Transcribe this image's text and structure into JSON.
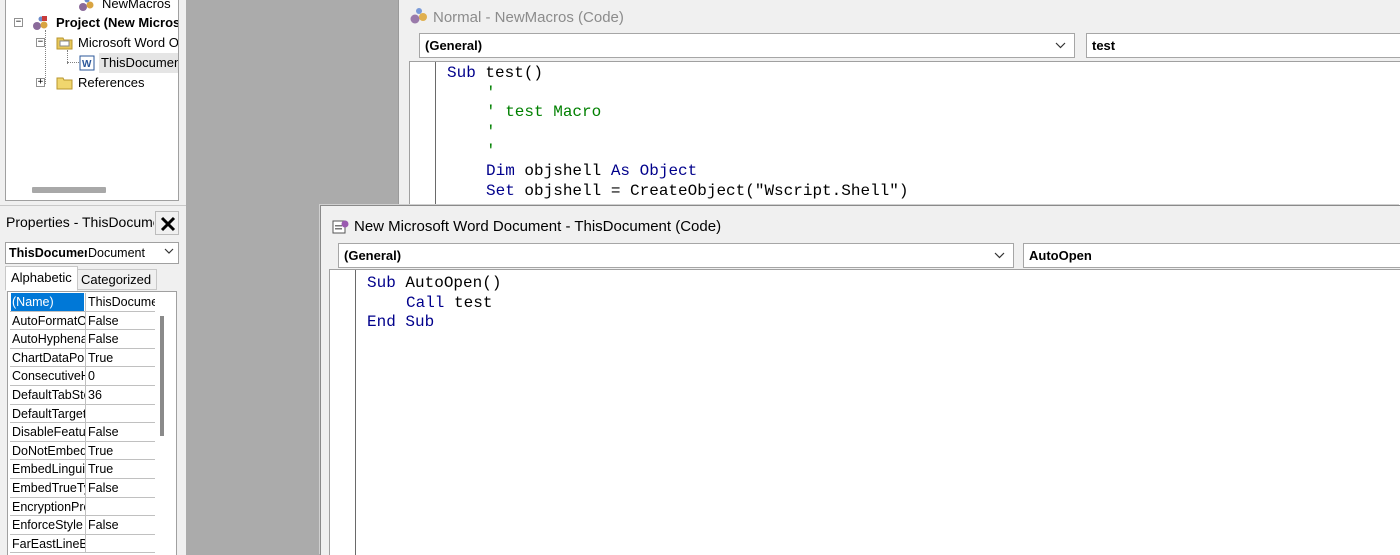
{
  "project_tree": {
    "items": [
      {
        "label": "NewMacros"
      },
      {
        "label": "Project (New Microsoft Word Document)"
      },
      {
        "label": "Microsoft Word Objects"
      },
      {
        "label": "ThisDocument"
      },
      {
        "label": "References"
      }
    ]
  },
  "properties": {
    "title": "Properties - ThisDocument",
    "object_name": "ThisDocument",
    "object_type": "Document",
    "tabs": {
      "alphabetic": "Alphabetic",
      "categorized": "Categorized"
    },
    "rows": [
      {
        "name": "(Name)",
        "value": "ThisDocument"
      },
      {
        "name": "AutoFormatOverride",
        "value": "False"
      },
      {
        "name": "AutoHyphenation",
        "value": "False"
      },
      {
        "name": "ChartDataPointTrack",
        "value": "True"
      },
      {
        "name": "ConsecutiveHyphensLimit",
        "value": "0"
      },
      {
        "name": "DefaultTabStop",
        "value": "36"
      },
      {
        "name": "DefaultTargetFrame",
        "value": ""
      },
      {
        "name": "DisableFeatures",
        "value": "False"
      },
      {
        "name": "DoNotEmbedSystemFonts",
        "value": "True"
      },
      {
        "name": "EmbedLinguisticData",
        "value": "True"
      },
      {
        "name": "EmbedTrueTypeFonts",
        "value": "False"
      },
      {
        "name": "EncryptionProvider",
        "value": ""
      },
      {
        "name": "EnforceStyle",
        "value": "False"
      },
      {
        "name": "FarEastLineBreakLevel",
        "value": ""
      }
    ]
  },
  "macros_window": {
    "title": "Normal - NewMacros (Code)",
    "object_combo": "(General)",
    "procedure_combo": "test",
    "code": [
      {
        "indent": 0,
        "parts": [
          {
            "t": "kw",
            "s": "Sub "
          },
          {
            "t": "tx",
            "s": "test()"
          }
        ]
      },
      {
        "indent": 1,
        "parts": [
          {
            "t": "cm",
            "s": "'"
          }
        ]
      },
      {
        "indent": 1,
        "parts": [
          {
            "t": "cm",
            "s": "' test Macro"
          }
        ]
      },
      {
        "indent": 1,
        "parts": [
          {
            "t": "cm",
            "s": "'"
          }
        ]
      },
      {
        "indent": 1,
        "parts": [
          {
            "t": "cm",
            "s": "'"
          }
        ]
      },
      {
        "indent": 1,
        "parts": [
          {
            "t": "kw",
            "s": "Dim "
          },
          {
            "t": "tx",
            "s": "objshell "
          },
          {
            "t": "kw",
            "s": "As "
          },
          {
            "t": "kw",
            "s": "Object"
          }
        ]
      },
      {
        "indent": 1,
        "parts": [
          {
            "t": "kw",
            "s": "Set "
          },
          {
            "t": "tx",
            "s": "objshell = CreateObject(\"Wscript.Shell\")"
          }
        ]
      }
    ]
  },
  "document_window": {
    "title": "New Microsoft Word Document - ThisDocument (Code)",
    "object_combo": "(General)",
    "procedure_combo": "AutoOpen",
    "code": [
      {
        "indent": 0,
        "parts": [
          {
            "t": "kw",
            "s": "Sub "
          },
          {
            "t": "tx",
            "s": "AutoOpen()"
          }
        ]
      },
      {
        "indent": 1,
        "parts": [
          {
            "t": "kw",
            "s": "Call "
          },
          {
            "t": "tx",
            "s": "test"
          }
        ]
      },
      {
        "indent": 0,
        "parts": [
          {
            "t": "kw",
            "s": "End Sub"
          }
        ]
      }
    ]
  },
  "colors": {
    "keyword": "#00008b",
    "comment": "#008000",
    "selection": "#0078d7"
  }
}
